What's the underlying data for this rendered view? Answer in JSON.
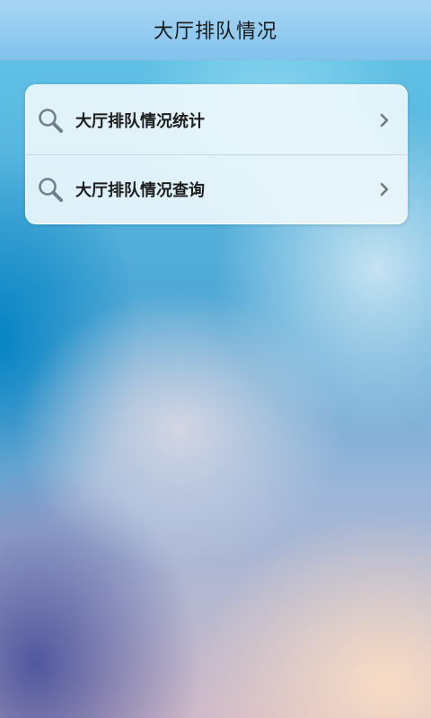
{
  "header": {
    "title": "大厅排队情况"
  },
  "menu": {
    "items": [
      {
        "label": "大厅排队情况统计",
        "icon": "search-icon",
        "trailing_icon": "chevron-right-icon"
      },
      {
        "label": "大厅排队情况查询",
        "icon": "search-icon",
        "trailing_icon": "chevron-right-icon"
      }
    ]
  },
  "colors": {
    "header_bg": "#8ccaf0",
    "card_bg": "#f0f8fc",
    "divider": "#c9d9e3",
    "icon": "#6e7f8c"
  }
}
